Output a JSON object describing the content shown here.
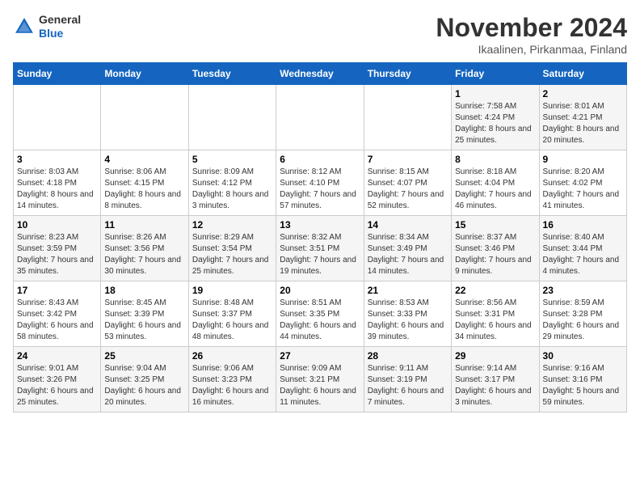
{
  "logo": {
    "general": "General",
    "blue": "Blue"
  },
  "header": {
    "month": "November 2024",
    "location": "Ikaalinen, Pirkanmaa, Finland"
  },
  "weekdays": [
    "Sunday",
    "Monday",
    "Tuesday",
    "Wednesday",
    "Thursday",
    "Friday",
    "Saturday"
  ],
  "weeks": [
    [
      {
        "day": "",
        "info": ""
      },
      {
        "day": "",
        "info": ""
      },
      {
        "day": "",
        "info": ""
      },
      {
        "day": "",
        "info": ""
      },
      {
        "day": "",
        "info": ""
      },
      {
        "day": "1",
        "info": "Sunrise: 7:58 AM\nSunset: 4:24 PM\nDaylight: 8 hours and 25 minutes."
      },
      {
        "day": "2",
        "info": "Sunrise: 8:01 AM\nSunset: 4:21 PM\nDaylight: 8 hours and 20 minutes."
      }
    ],
    [
      {
        "day": "3",
        "info": "Sunrise: 8:03 AM\nSunset: 4:18 PM\nDaylight: 8 hours and 14 minutes."
      },
      {
        "day": "4",
        "info": "Sunrise: 8:06 AM\nSunset: 4:15 PM\nDaylight: 8 hours and 8 minutes."
      },
      {
        "day": "5",
        "info": "Sunrise: 8:09 AM\nSunset: 4:12 PM\nDaylight: 8 hours and 3 minutes."
      },
      {
        "day": "6",
        "info": "Sunrise: 8:12 AM\nSunset: 4:10 PM\nDaylight: 7 hours and 57 minutes."
      },
      {
        "day": "7",
        "info": "Sunrise: 8:15 AM\nSunset: 4:07 PM\nDaylight: 7 hours and 52 minutes."
      },
      {
        "day": "8",
        "info": "Sunrise: 8:18 AM\nSunset: 4:04 PM\nDaylight: 7 hours and 46 minutes."
      },
      {
        "day": "9",
        "info": "Sunrise: 8:20 AM\nSunset: 4:02 PM\nDaylight: 7 hours and 41 minutes."
      }
    ],
    [
      {
        "day": "10",
        "info": "Sunrise: 8:23 AM\nSunset: 3:59 PM\nDaylight: 7 hours and 35 minutes."
      },
      {
        "day": "11",
        "info": "Sunrise: 8:26 AM\nSunset: 3:56 PM\nDaylight: 7 hours and 30 minutes."
      },
      {
        "day": "12",
        "info": "Sunrise: 8:29 AM\nSunset: 3:54 PM\nDaylight: 7 hours and 25 minutes."
      },
      {
        "day": "13",
        "info": "Sunrise: 8:32 AM\nSunset: 3:51 PM\nDaylight: 7 hours and 19 minutes."
      },
      {
        "day": "14",
        "info": "Sunrise: 8:34 AM\nSunset: 3:49 PM\nDaylight: 7 hours and 14 minutes."
      },
      {
        "day": "15",
        "info": "Sunrise: 8:37 AM\nSunset: 3:46 PM\nDaylight: 7 hours and 9 minutes."
      },
      {
        "day": "16",
        "info": "Sunrise: 8:40 AM\nSunset: 3:44 PM\nDaylight: 7 hours and 4 minutes."
      }
    ],
    [
      {
        "day": "17",
        "info": "Sunrise: 8:43 AM\nSunset: 3:42 PM\nDaylight: 6 hours and 58 minutes."
      },
      {
        "day": "18",
        "info": "Sunrise: 8:45 AM\nSunset: 3:39 PM\nDaylight: 6 hours and 53 minutes."
      },
      {
        "day": "19",
        "info": "Sunrise: 8:48 AM\nSunset: 3:37 PM\nDaylight: 6 hours and 48 minutes."
      },
      {
        "day": "20",
        "info": "Sunrise: 8:51 AM\nSunset: 3:35 PM\nDaylight: 6 hours and 44 minutes."
      },
      {
        "day": "21",
        "info": "Sunrise: 8:53 AM\nSunset: 3:33 PM\nDaylight: 6 hours and 39 minutes."
      },
      {
        "day": "22",
        "info": "Sunrise: 8:56 AM\nSunset: 3:31 PM\nDaylight: 6 hours and 34 minutes."
      },
      {
        "day": "23",
        "info": "Sunrise: 8:59 AM\nSunset: 3:28 PM\nDaylight: 6 hours and 29 minutes."
      }
    ],
    [
      {
        "day": "24",
        "info": "Sunrise: 9:01 AM\nSunset: 3:26 PM\nDaylight: 6 hours and 25 minutes."
      },
      {
        "day": "25",
        "info": "Sunrise: 9:04 AM\nSunset: 3:25 PM\nDaylight: 6 hours and 20 minutes."
      },
      {
        "day": "26",
        "info": "Sunrise: 9:06 AM\nSunset: 3:23 PM\nDaylight: 6 hours and 16 minutes."
      },
      {
        "day": "27",
        "info": "Sunrise: 9:09 AM\nSunset: 3:21 PM\nDaylight: 6 hours and 11 minutes."
      },
      {
        "day": "28",
        "info": "Sunrise: 9:11 AM\nSunset: 3:19 PM\nDaylight: 6 hours and 7 minutes."
      },
      {
        "day": "29",
        "info": "Sunrise: 9:14 AM\nSunset: 3:17 PM\nDaylight: 6 hours and 3 minutes."
      },
      {
        "day": "30",
        "info": "Sunrise: 9:16 AM\nSunset: 3:16 PM\nDaylight: 5 hours and 59 minutes."
      }
    ]
  ]
}
